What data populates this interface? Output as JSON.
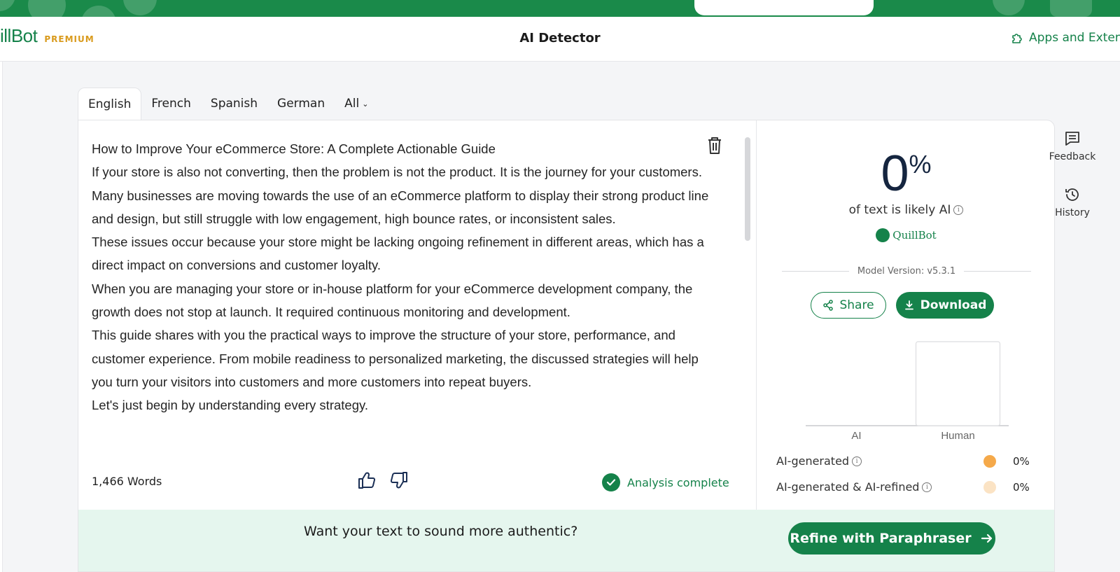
{
  "header": {
    "logo_name": "illBot",
    "logo_tier": "PREMIUM",
    "title": "AI Detector",
    "apps_link": "Apps and Exten"
  },
  "tabs": [
    {
      "label": "English",
      "active": true
    },
    {
      "label": "French",
      "active": false
    },
    {
      "label": "Spanish",
      "active": false
    },
    {
      "label": "German",
      "active": false
    },
    {
      "label": "All",
      "active": false
    }
  ],
  "editor": {
    "paragraphs": [
      "How to Improve Your eCommerce Store: A Complete Actionable Guide",
      "If your store is also not converting, then the problem is not the product. It is the journey for your customers.",
      "Many businesses are moving towards the use of an eCommerce platform to display their strong product line and design, but still struggle with low engagement, high bounce rates, or inconsistent sales.",
      "These issues occur because your store might be lacking ongoing refinement in different areas, which has a direct impact on conversions and customer loyalty.",
      "When you are managing your store or in-house platform for your eCommerce development company, the growth does not stop at launch. It required continuous monitoring and development.",
      "This guide shares with you the practical ways to improve the structure of your store, performance, and customer experience. From mobile readiness to personalized marketing, the discussed strategies will help you turn your visitors into customers and more customers into repeat buyers.",
      "Let's just begin by understanding every strategy."
    ],
    "word_count": "1,466 Words",
    "status": "Analysis complete"
  },
  "result": {
    "percent": "0",
    "percent_sign": "%",
    "likely_label": "of text is likely AI",
    "brand": "QuillBot",
    "model_version": "Model Version: v5.3.1",
    "share_label": "Share",
    "download_label": "Download"
  },
  "chart_data": {
    "type": "bar",
    "categories": [
      "AI",
      "Human"
    ],
    "values": [
      0,
      100
    ],
    "ylim": [
      0,
      100
    ]
  },
  "legend": [
    {
      "label": "AI-generated",
      "value": "0%",
      "color": "#f5a94a"
    },
    {
      "label": "AI-generated & AI-refined",
      "value": "0%",
      "color": "#fbe3c4"
    }
  ],
  "cta": {
    "text": "Want your text to sound more authentic?",
    "button": "Refine with Paraphraser"
  },
  "rail": {
    "feedback": "Feedback",
    "history": "History"
  },
  "colors": {
    "brand_green": "#15824a",
    "banner_green": "#1a8a4a",
    "cta_bg": "#e5f6ee",
    "premium_gold": "#d99a1c"
  }
}
